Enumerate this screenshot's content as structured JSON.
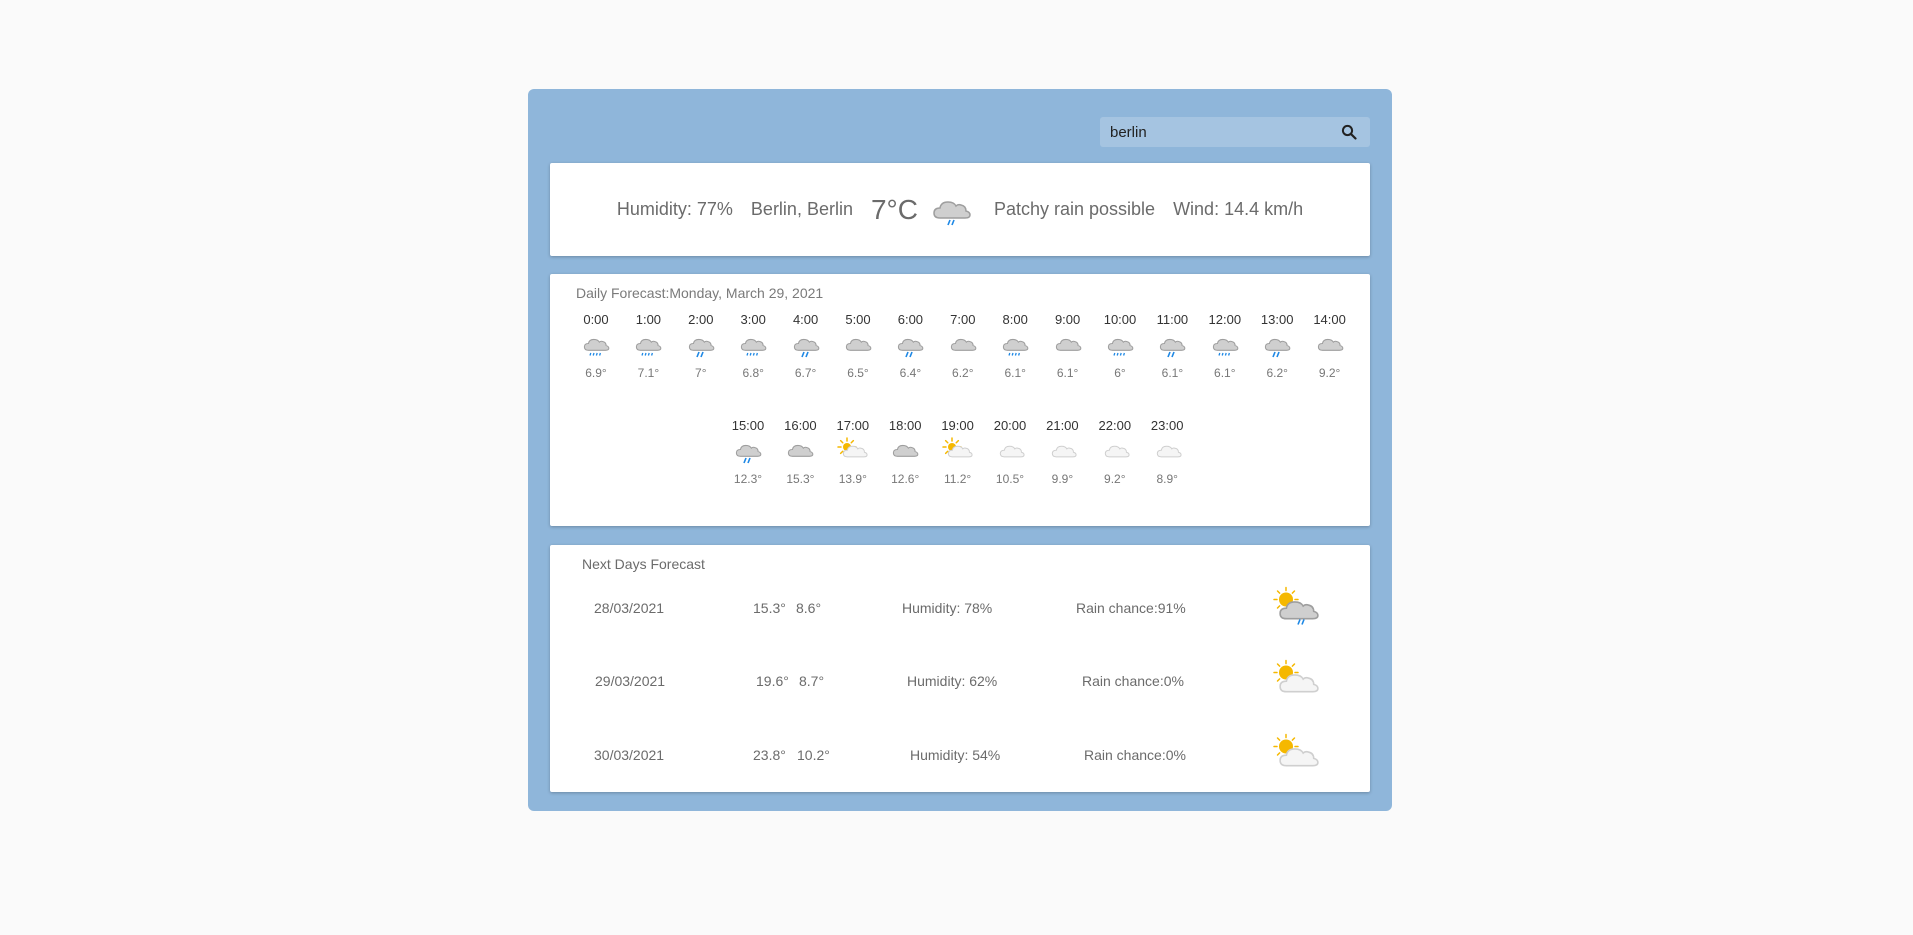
{
  "search": {
    "value": "berlin",
    "placeholder": "berlin",
    "icon": "search-icon"
  },
  "current": {
    "humidity": "Humidity: 77%",
    "location": "Berlin, Berlin",
    "temperature": "7°C",
    "icon": "night-rain-icon",
    "condition": "Patchy rain possible",
    "wind": "Wind: 14.4 km/h"
  },
  "daily": {
    "title": "Daily Forecast:Monday, March 29, 2021",
    "hours": [
      {
        "time": "0:00",
        "temp": "6.9°",
        "icon": "cloud-drizzle"
      },
      {
        "time": "1:00",
        "temp": "7.1°",
        "icon": "cloud-drizzle"
      },
      {
        "time": "2:00",
        "temp": "7°",
        "icon": "night-cloud-rain"
      },
      {
        "time": "3:00",
        "temp": "6.8°",
        "icon": "cloud-drizzle"
      },
      {
        "time": "4:00",
        "temp": "6.7°",
        "icon": "night-cloud-rain"
      },
      {
        "time": "5:00",
        "temp": "6.5°",
        "icon": "cloud"
      },
      {
        "time": "6:00",
        "temp": "6.4°",
        "icon": "night-cloud-rain"
      },
      {
        "time": "7:00",
        "temp": "6.2°",
        "icon": "cloud"
      },
      {
        "time": "8:00",
        "temp": "6.1°",
        "icon": "cloud-drizzle"
      },
      {
        "time": "9:00",
        "temp": "6.1°",
        "icon": "cloud"
      },
      {
        "time": "10:00",
        "temp": "6°",
        "icon": "cloud-drizzle"
      },
      {
        "time": "11:00",
        "temp": "6.1°",
        "icon": "cloud-rain"
      },
      {
        "time": "12:00",
        "temp": "6.1°",
        "icon": "cloud-drizzle"
      },
      {
        "time": "13:00",
        "temp": "6.2°",
        "icon": "cloud-rain"
      },
      {
        "time": "14:00",
        "temp": "9.2°",
        "icon": "cloud"
      },
      {
        "time": "15:00",
        "temp": "12.3°",
        "icon": "cloud-rain"
      },
      {
        "time": "16:00",
        "temp": "15.3°",
        "icon": "cloud"
      },
      {
        "time": "17:00",
        "temp": "13.9°",
        "icon": "sun-cloud"
      },
      {
        "time": "18:00",
        "temp": "12.6°",
        "icon": "cloud"
      },
      {
        "time": "19:00",
        "temp": "11.2°",
        "icon": "sun-cloud"
      },
      {
        "time": "20:00",
        "temp": "10.5°",
        "icon": "night-cloud"
      },
      {
        "time": "21:00",
        "temp": "9.9°",
        "icon": "night-cloud"
      },
      {
        "time": "22:00",
        "temp": "9.2°",
        "icon": "night-cloud"
      },
      {
        "time": "23:00",
        "temp": "8.9°",
        "icon": "night-cloud"
      }
    ]
  },
  "next_days": {
    "title": "Next Days Forecast",
    "rows": [
      {
        "date": "28/03/2021",
        "max": "15.3°",
        "min": "8.6°",
        "humidity": "Humidity: 78%",
        "rain": "Rain chance:91%",
        "icon": "sun-cloud-rain"
      },
      {
        "date": "29/03/2021",
        "max": "19.6°",
        "min": "8.7°",
        "humidity": "Humidity: 62%",
        "rain": "Rain chance:0%",
        "icon": "sun-cloud"
      },
      {
        "date": "30/03/2021",
        "max": "23.8°",
        "min": "10.2°",
        "humidity": "Humidity: 54%",
        "rain": "Rain chance:0%",
        "icon": "sun-cloud"
      }
    ]
  },
  "colors": {
    "app_bg": "#8fb6da",
    "search_bg": "#a5c4e1",
    "sun": "#f5b800",
    "moon": "#1e88e5",
    "rain": "#1e88e5",
    "cloud_grey": "#c7c7c7",
    "cloud_white": "#f5f5f5"
  }
}
